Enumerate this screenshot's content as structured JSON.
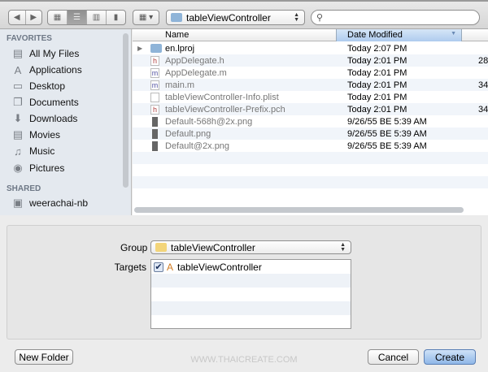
{
  "toolbar": {
    "path": "tableViewController",
    "search_placeholder": ""
  },
  "sidebar": {
    "favorites_heading": "FAVORITES",
    "favorites": [
      {
        "label": "All My Files",
        "icon": "all-files-icon"
      },
      {
        "label": "Applications",
        "icon": "applications-icon"
      },
      {
        "label": "Desktop",
        "icon": "desktop-icon"
      },
      {
        "label": "Documents",
        "icon": "documents-icon"
      },
      {
        "label": "Downloads",
        "icon": "downloads-icon"
      },
      {
        "label": "Movies",
        "icon": "movies-icon"
      },
      {
        "label": "Music",
        "icon": "music-icon"
      },
      {
        "label": "Pictures",
        "icon": "pictures-icon"
      }
    ],
    "shared_heading": "SHARED",
    "shared": [
      {
        "label": "weerachai-nb",
        "icon": "computer-icon"
      }
    ]
  },
  "list": {
    "columns": {
      "name": "Name",
      "date": "Date Modified"
    },
    "rows": [
      {
        "name": "en.lproj",
        "date": "Today 2:07 PM",
        "size": "",
        "type": "folder",
        "icon": "f"
      },
      {
        "name": "AppDelegate.h",
        "date": "Today 2:01 PM",
        "size": "28",
        "type": "h",
        "icon": "h"
      },
      {
        "name": "AppDelegate.m",
        "date": "Today 2:01 PM",
        "size": "",
        "type": "m",
        "icon": "m"
      },
      {
        "name": "main.m",
        "date": "Today 2:01 PM",
        "size": "34",
        "type": "m",
        "icon": "m"
      },
      {
        "name": "tableViewController-Info.plist",
        "date": "Today 2:01 PM",
        "size": "",
        "type": "plist",
        "icon": ""
      },
      {
        "name": "tableViewController-Prefix.pch",
        "date": "Today 2:01 PM",
        "size": "34",
        "type": "h",
        "icon": "h"
      },
      {
        "name": "Default-568h@2x.png",
        "date": "9/26/55 BE 5:39 AM",
        "size": "",
        "type": "png",
        "icon": ""
      },
      {
        "name": "Default.png",
        "date": "9/26/55 BE 5:39 AM",
        "size": "",
        "type": "png",
        "icon": ""
      },
      {
        "name": "Default@2x.png",
        "date": "9/26/55 BE 5:39 AM",
        "size": "",
        "type": "png",
        "icon": ""
      }
    ]
  },
  "options": {
    "group_label": "Group",
    "group_value": "tableViewController",
    "targets_label": "Targets",
    "targets": [
      {
        "label": "tableViewController",
        "checked": true
      }
    ]
  },
  "buttons": {
    "new_folder": "New Folder",
    "cancel": "Cancel",
    "create": "Create"
  },
  "watermark": "WWW.THAICREATE.COM"
}
